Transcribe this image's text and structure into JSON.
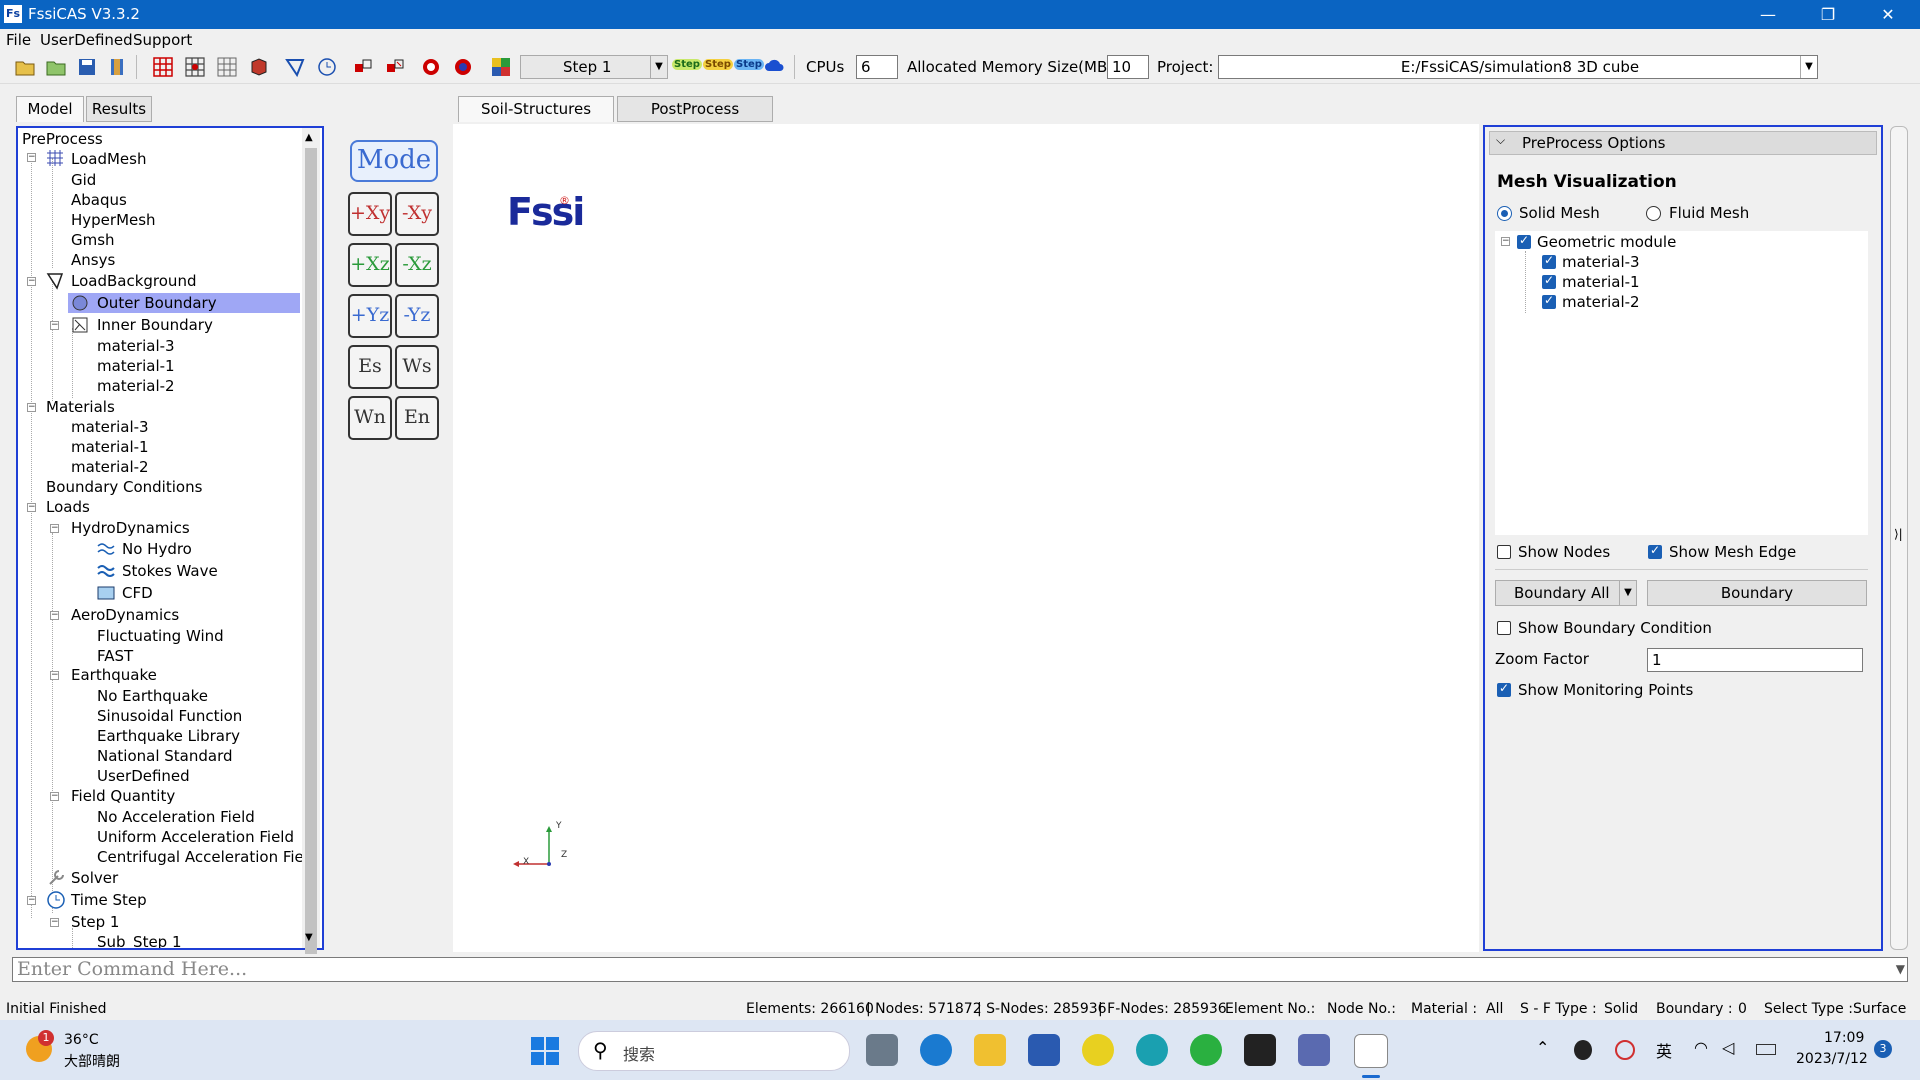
{
  "window": {
    "title": "FssiCAS V3.3.2",
    "app_icon": "Fs",
    "minimize": "—",
    "restore": "❐",
    "close": "✕"
  },
  "menu": [
    "File",
    "UserDefined",
    "Support"
  ],
  "toolbar": {
    "step_value": "Step 1",
    "step_buttons": [
      "Step",
      "Step",
      "Step"
    ],
    "cpus_label": "CPUs",
    "cpus_value": "6",
    "memory_label": "Allocated Memory Size(MB) :",
    "memory_value": "10",
    "project_label": "Project:",
    "project_value": "E:/FssiCAS/simulation8 3D cube"
  },
  "left_tabs": [
    "Model",
    "Results"
  ],
  "center_tabs": [
    "Soil-Structures",
    "PostProcess"
  ],
  "tree": {
    "root": "PreProcess",
    "loadmesh": "LoadMesh",
    "mesh_items": [
      "Gid",
      "Abaqus",
      "HyperMesh",
      "Gmsh",
      "Ansys"
    ],
    "loadbackground": "LoadBackground",
    "outer_boundary": "Outer Boundary",
    "inner_boundary": "Inner Boundary",
    "inner_items": [
      "material-3",
      "material-1",
      "material-2"
    ],
    "materials": "Materials",
    "material_items": [
      "material-3",
      "material-1",
      "material-2"
    ],
    "boundary_conditions": "Boundary Conditions",
    "loads": "Loads",
    "hydro": "HydroDynamics",
    "hydro_items": [
      "No Hydro",
      "Stokes Wave",
      "CFD"
    ],
    "aero": "AeroDynamics",
    "aero_items": [
      "Fluctuating Wind",
      "FAST"
    ],
    "earthquake": "Earthquake",
    "earthquake_items": [
      "No Earthquake",
      "Sinusoidal Function",
      "Earthquake Library",
      "National Standard",
      "UserDefined"
    ],
    "field": "Field Quantity",
    "field_items": [
      "No Acceleration Field",
      "Uniform Acceleration Field",
      "Centrifugal Acceleration Field"
    ],
    "solver": "Solver",
    "timestep": "Time Step",
    "step": "Step 1",
    "substep": "Sub_Step 1"
  },
  "view_buttons": {
    "mode": "Mode",
    "labels": [
      [
        "+Xy",
        "-Xy"
      ],
      [
        "+Xz",
        "-Xz"
      ],
      [
        "+Yz",
        "-Yz"
      ],
      [
        "Es",
        "Ws"
      ],
      [
        "Wn",
        "En"
      ]
    ]
  },
  "canvas": {
    "logo": "Fssi",
    "logo_mark": "®",
    "axis_y": "Y",
    "axis_x": "X",
    "axis_z": "Z"
  },
  "options": {
    "header": "PreProcess Options",
    "section": "Mesh Visualization",
    "solid_mesh": "Solid Mesh",
    "fluid_mesh": "Fluid Mesh",
    "geo_module": "Geometric module",
    "geo_items": [
      "material-3",
      "material-1",
      "material-2"
    ],
    "show_nodes": "Show Nodes",
    "show_mesh_edge": "Show Mesh Edge",
    "boundary_all": "Boundary All",
    "boundary": "Boundary",
    "show_bc": "Show Boundary Condition",
    "zoom_label": "Zoom Factor",
    "zoom_value": "1",
    "show_monitoring": "Show Monitoring Points"
  },
  "command_placeholder": "Enter Command Here...",
  "status": {
    "left": "Initial Finished",
    "elements": "Elements: 266160",
    "nodes": "| Nodes: 571872",
    "snodes": "| S-Nodes: 285936",
    "fnodes": "| F-Nodes: 285936",
    "element_no": "Element No.:",
    "node_no": "Node No.:",
    "material": "Material :",
    "material_value": "All",
    "sf_type": "S - F Type :",
    "sf_value": "Solid",
    "boundary": "Boundary :",
    "boundary_value": "0",
    "select_type": "Select Type :",
    "select_value": "Surface"
  },
  "taskbar": {
    "weather_temp": "36°C",
    "weather_desc": "大部晴朗",
    "weather_badge": "1",
    "search": "搜索",
    "ime": "英",
    "time": "17:09",
    "date": "2023/7/12",
    "notif": "3"
  },
  "colors": {
    "titlebar": "#0a64c2",
    "selection": "#9fa7f5",
    "panel_border": "#1f3fd6"
  }
}
